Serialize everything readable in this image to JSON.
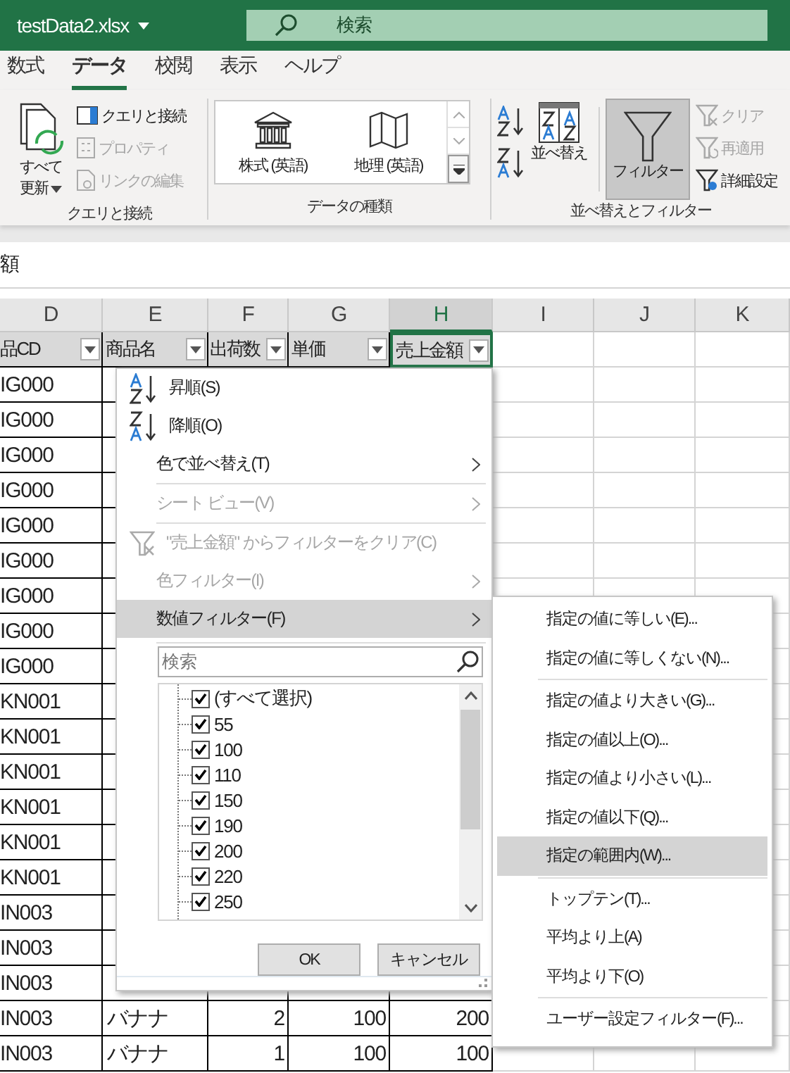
{
  "title_bar": {
    "file_name": "testData2.xlsx",
    "search": {
      "placeholder": "検索"
    }
  },
  "ribbon_tabs": [
    {
      "label": "数式",
      "selected": false
    },
    {
      "label": "データ",
      "selected": true
    },
    {
      "label": "校閲",
      "selected": false
    },
    {
      "label": "表示",
      "selected": false
    },
    {
      "label": "ヘルプ",
      "selected": false
    }
  ],
  "ribbon_groups": [
    {
      "label": "クエリと接続",
      "kind": "query",
      "large_button": {
        "lines": [
          "すべて",
          "更新"
        ],
        "has_menu": true
      },
      "small_buttons": [
        {
          "label": "クエリと接続",
          "disabled": false
        },
        {
          "label": "プロパティ",
          "disabled": true
        },
        {
          "label": "リンクの編集",
          "disabled": true
        }
      ]
    },
    {
      "label": "データの種類",
      "kind": "gallery",
      "gallery_items": [
        {
          "label": "株式 (英語)"
        },
        {
          "label": "地理 (英語)"
        }
      ]
    },
    {
      "label": "並べ替えとフィルター",
      "kind": "sort_filter",
      "sort_button": {
        "label": "並べ替え"
      },
      "filter_button": {
        "label": "フィルター",
        "selected": true
      },
      "small_buttons": [
        {
          "label": "クリア",
          "disabled": true
        },
        {
          "label": "再適用",
          "disabled": true
        },
        {
          "label": "詳細設定",
          "disabled": false
        }
      ]
    }
  ],
  "formula_bar": {
    "value": "額"
  },
  "sheet": {
    "columns": [
      {
        "label": "D",
        "selected": false
      },
      {
        "label": "E",
        "selected": false
      },
      {
        "label": "F",
        "selected": false
      },
      {
        "label": "G",
        "selected": false
      },
      {
        "label": "H",
        "selected": true
      },
      {
        "label": "I",
        "selected": false
      },
      {
        "label": "J",
        "selected": false
      },
      {
        "label": "K",
        "selected": false
      }
    ],
    "header_cells": [
      {
        "text": "品CD",
        "selected": false
      },
      {
        "text": "商品名",
        "selected": false
      },
      {
        "text": "出荷数",
        "selected": false
      },
      {
        "text": "単価",
        "selected": false
      },
      {
        "text": "売上金額",
        "selected": true
      }
    ],
    "rows": [
      [
        "IG000"
      ],
      [
        "IG000"
      ],
      [
        "IG000"
      ],
      [
        "IG000"
      ],
      [
        "IG000"
      ],
      [
        "IG000"
      ],
      [
        "IG000"
      ],
      [
        "IG000"
      ],
      [
        "IG000"
      ],
      [
        "KN001"
      ],
      [
        "KN001"
      ],
      [
        "KN001"
      ],
      [
        "KN001"
      ],
      [
        "KN001"
      ],
      [
        "KN001"
      ],
      [
        "IN003"
      ],
      [
        "IN003"
      ],
      [
        "IN003"
      ],
      [
        "IN003",
        "バナナ",
        "2",
        "100",
        "200"
      ],
      [
        "IN003",
        "バナナ",
        "1",
        "100",
        "100"
      ]
    ]
  },
  "filter_menu": {
    "items": [
      {
        "label": "昇順(S)",
        "kind": "sort_ascending",
        "disabled": false,
        "selected": false,
        "separator_before": false
      },
      {
        "label": "降順(O)",
        "kind": "sort_descending",
        "disabled": false,
        "selected": false,
        "separator_before": false
      },
      {
        "label": "色で並べ替え(T)",
        "kind": "submenu",
        "disabled": false,
        "selected": false,
        "separator_before": false
      },
      {
        "label": "シート ビュー(V)",
        "kind": "submenu",
        "disabled": true,
        "selected": false,
        "separator_before": true
      },
      {
        "label": "\"売上金額\" からフィルターをクリア(C)",
        "kind": "clear_filter",
        "disabled": true,
        "selected": false,
        "separator_before": true
      },
      {
        "label": "色フィルター(I)",
        "kind": "submenu",
        "disabled": true,
        "selected": false,
        "separator_before": false
      },
      {
        "label": "数値フィルター(F)",
        "kind": "submenu",
        "disabled": false,
        "selected": true,
        "separator_before": false
      }
    ],
    "search": {
      "placeholder": "検索"
    },
    "values": [
      {
        "label": "(すべて選択)",
        "checked": true
      },
      {
        "label": "55",
        "checked": true
      },
      {
        "label": "100",
        "checked": true
      },
      {
        "label": "110",
        "checked": true
      },
      {
        "label": "150",
        "checked": true
      },
      {
        "label": "190",
        "checked": true
      },
      {
        "label": "200",
        "checked": true
      },
      {
        "label": "220",
        "checked": true
      },
      {
        "label": "250",
        "checked": true
      }
    ],
    "buttons": [
      "OK",
      "キャンセル"
    ]
  },
  "number_filter_menu": {
    "items": [
      {
        "label": "指定の値に等しい(E)...",
        "selected": false,
        "separator_before": false
      },
      {
        "label": "指定の値に等しくない(N)...",
        "selected": false,
        "separator_before": false
      },
      {
        "label": "指定の値より大きい(G)...",
        "selected": false,
        "separator_before": true
      },
      {
        "label": "指定の値以上(O)...",
        "selected": false,
        "separator_before": false
      },
      {
        "label": "指定の値より小さい(L)...",
        "selected": false,
        "separator_before": false
      },
      {
        "label": "指定の値以下(Q)...",
        "selected": false,
        "separator_before": false
      },
      {
        "label": "指定の範囲内(W)...",
        "selected": true,
        "separator_before": false
      },
      {
        "label": "トップテン(T)...",
        "selected": false,
        "separator_before": true
      },
      {
        "label": "平均より上(A)",
        "selected": false,
        "separator_before": false
      },
      {
        "label": "平均より下(O)",
        "selected": false,
        "separator_before": false
      },
      {
        "label": "ユーザー設定フィルター(F)...",
        "selected": false,
        "separator_before": true
      }
    ]
  }
}
